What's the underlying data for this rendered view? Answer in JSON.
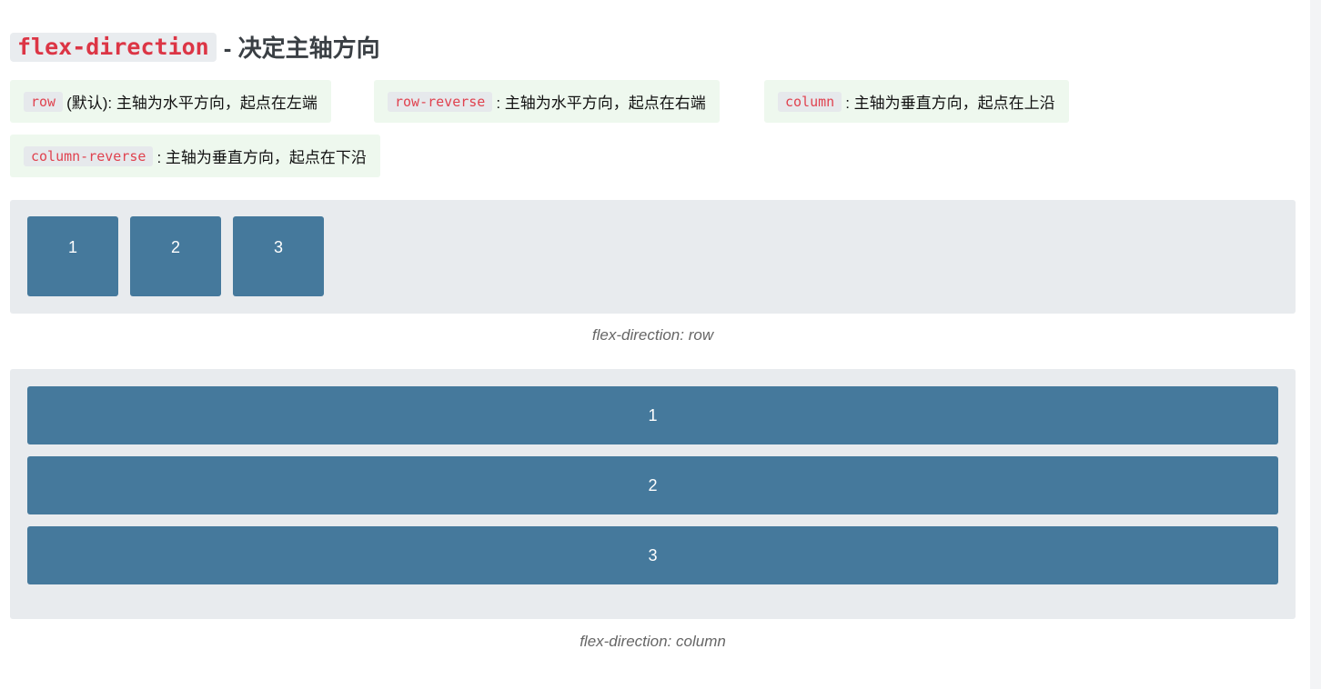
{
  "heading": {
    "code": "flex-direction",
    "text": "- 决定主轴方向"
  },
  "descriptions": [
    {
      "code": "row",
      "text": "(默认): 主轴为水平方向，起点在左端"
    },
    {
      "code": "row-reverse",
      "text": ": 主轴为水平方向，起点在右端"
    },
    {
      "code": "column",
      "text": ": 主轴为垂直方向，起点在上沿"
    },
    {
      "code": "column-reverse",
      "text": ": 主轴为垂直方向，起点在下沿"
    }
  ],
  "demo_row": {
    "items": [
      "1",
      "2",
      "3"
    ],
    "caption": "flex-direction: row"
  },
  "demo_column": {
    "items": [
      "1",
      "2",
      "3"
    ],
    "caption": "flex-direction: column"
  },
  "colors": {
    "box": "#45799c",
    "code_text": "#dc3545",
    "desc_bg": "#eef8ee",
    "demo_bg": "#e8ebee"
  }
}
